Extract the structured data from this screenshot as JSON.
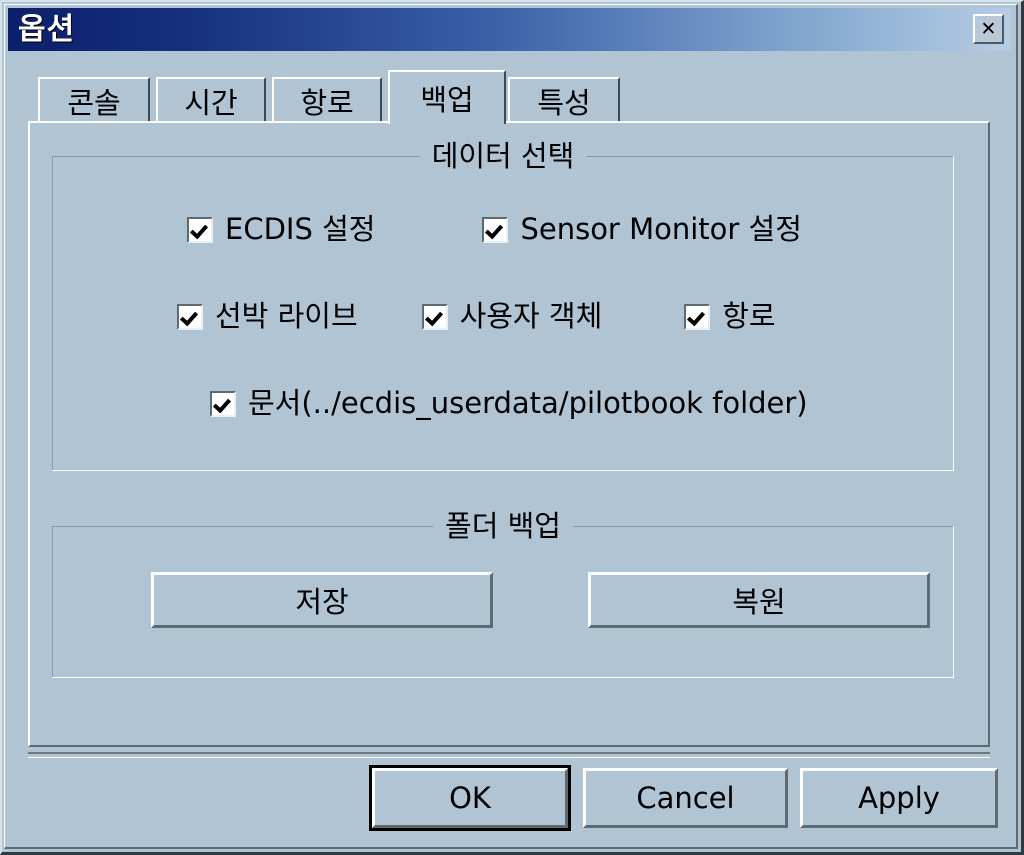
{
  "window": {
    "title": "옵션",
    "close_label": "✕",
    "bg_color": "#b0c4d4",
    "titlebar_color_start": "#0c1f6b",
    "titlebar_color_end": "#b6cde4"
  },
  "tabs": [
    {
      "label": "콘솔",
      "selected": false
    },
    {
      "label": "시간",
      "selected": false
    },
    {
      "label": "항로",
      "selected": false
    },
    {
      "label": "백업",
      "selected": true
    },
    {
      "label": "특성",
      "selected": false
    }
  ],
  "data_selection_group": {
    "title": "데이터 선택",
    "rows": [
      [
        {
          "label": "ECDIS 설정",
          "checked": true
        },
        {
          "label": "Sensor Monitor 설정",
          "checked": true
        }
      ],
      [
        {
          "label": "선박 라이브",
          "checked": true
        },
        {
          "label": "사용자 객체",
          "checked": true
        },
        {
          "label": "항로",
          "checked": true
        }
      ],
      [
        {
          "label": "문서(../ecdis_userdata/pilotbook  folder)",
          "checked": true
        }
      ]
    ]
  },
  "folder_backup_group": {
    "title": "폴더 백업",
    "save_label": "저장",
    "restore_label": "복원"
  },
  "dialog_buttons": {
    "ok_label": "OK",
    "cancel_label": "Cancel",
    "apply_label": "Apply"
  }
}
